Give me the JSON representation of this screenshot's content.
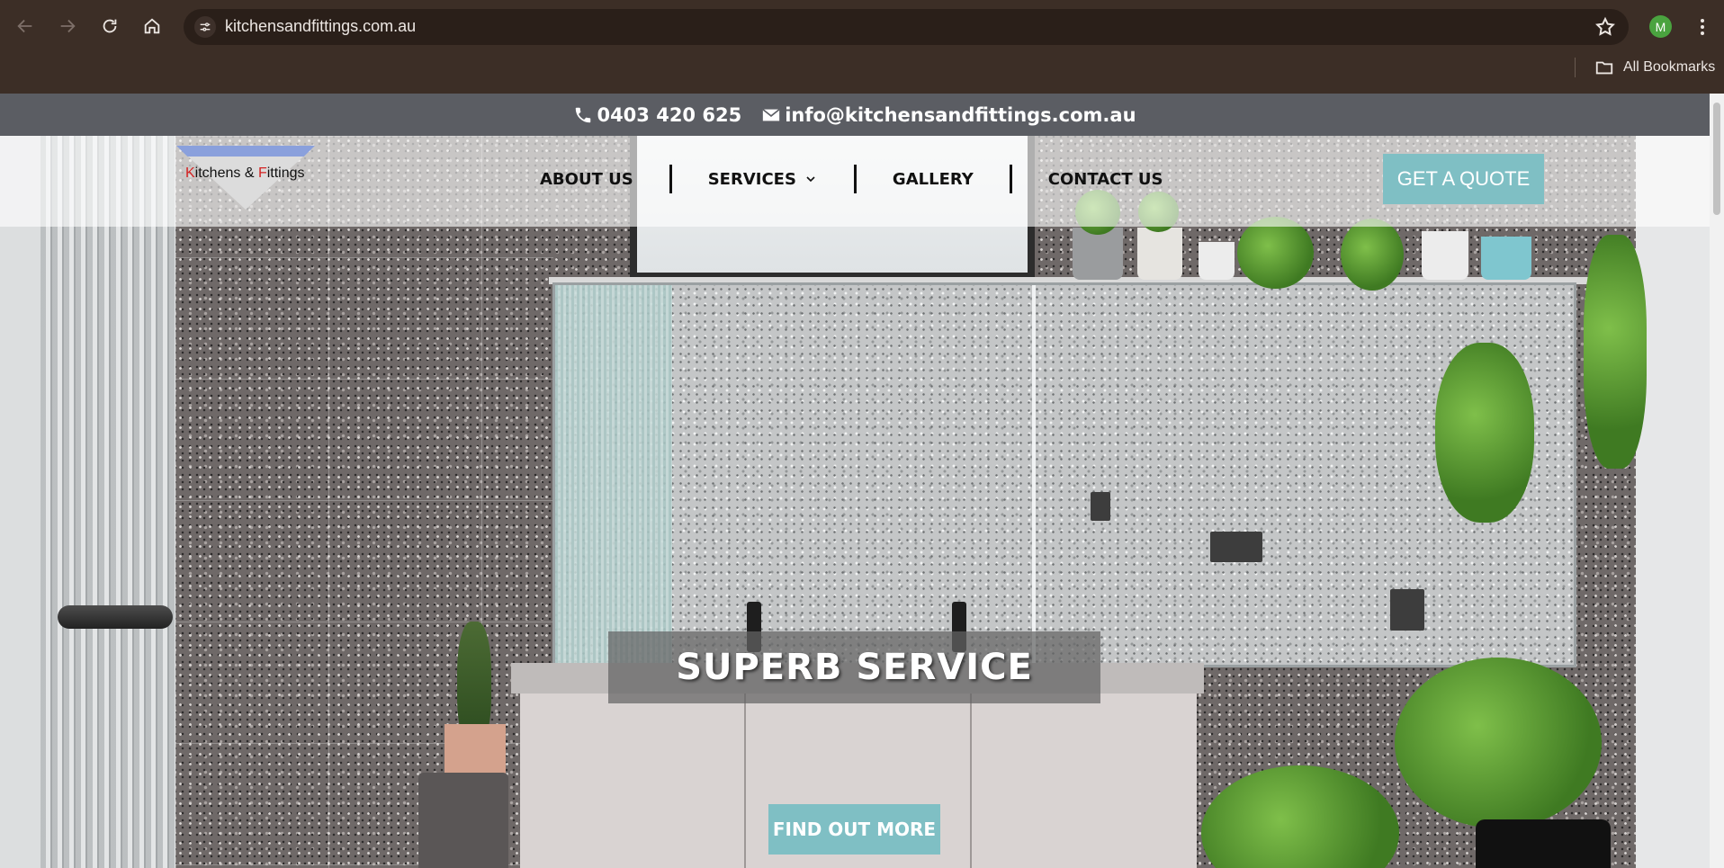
{
  "browser": {
    "url": "kitchensandfittings.com.au",
    "profile_initial": "M",
    "bookmarks_label": "All Bookmarks",
    "icons": [
      "back-icon",
      "forward-icon",
      "reload-icon",
      "home-icon",
      "site-info-icon",
      "bookmark-star-icon",
      "kebab-menu-icon",
      "folder-icon"
    ]
  },
  "topbar": {
    "phone": "0403 420 625",
    "email": "info@kitchensandfittings.com.au",
    "icons": [
      "phone-icon",
      "envelope-icon"
    ]
  },
  "logo": {
    "part1_initial": "K",
    "part1_rest": "itchens & ",
    "part2_initial": "F",
    "part2_rest": "ittings"
  },
  "nav": {
    "items": [
      {
        "label": "ABOUT US"
      },
      {
        "label": "SERVICES"
      },
      {
        "label": "GALLERY"
      },
      {
        "label": "CONTACT US"
      }
    ],
    "cta": "GET A QUOTE"
  },
  "hero": {
    "title": "SUPERB SERVICE",
    "button": "FIND OUT MORE"
  },
  "colors": {
    "chrome": "#3c2e26",
    "topbar": "#5b5d63",
    "accent": "#7fbfc4",
    "logo_red": "#d42222",
    "logo_blue": "#8aa0dc",
    "avatar": "#4aa33f"
  }
}
